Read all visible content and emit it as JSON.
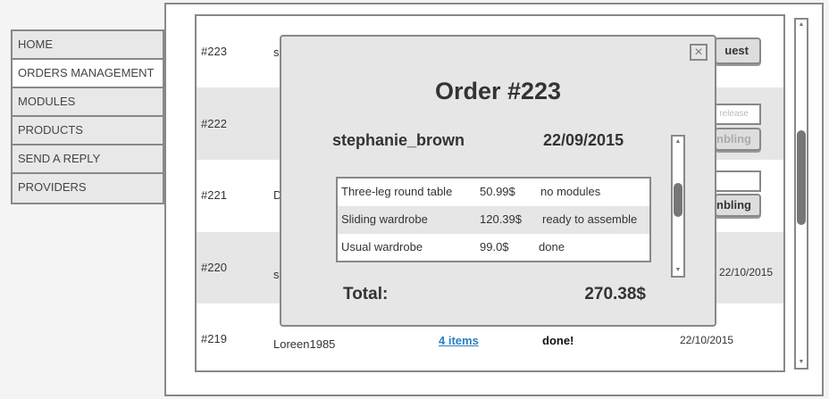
{
  "menu": {
    "items": [
      {
        "label": "HOME"
      },
      {
        "label": "ORDERS MANAGEMENT"
      },
      {
        "label": "MODULES"
      },
      {
        "label": "PRODUCTS"
      },
      {
        "label": "SEND A REPLY"
      },
      {
        "label": "PROVIDERS"
      }
    ]
  },
  "orders": {
    "rows": [
      {
        "id": "#223",
        "user_fragment": "s",
        "button_fragment": "uest"
      },
      {
        "id": "#222",
        "input_placeholder_fragment": "release",
        "button_fragment": "nbling"
      },
      {
        "id": "#221",
        "user_fragment": "D",
        "button_fragment": "nbling"
      },
      {
        "id": "#220",
        "user_fragment": "s",
        "date": "22/10/2015"
      },
      {
        "id": "#219",
        "user": "Loreen1985",
        "items_link": "4 items",
        "status": "done!",
        "date": "22/10/2015"
      }
    ]
  },
  "modal": {
    "title": "Order #223",
    "username": "stephanie_brown",
    "date": "22/09/2015",
    "items": [
      {
        "name": "Three-leg round table",
        "price": "50.99$",
        "status": "no modules"
      },
      {
        "name": "Sliding wardrobe",
        "price": "120.39$",
        "status": "ready to assemble"
      },
      {
        "name": "Usual wardrobe",
        "price": "99.0$",
        "status": "done"
      }
    ],
    "total_label": "Total:",
    "total_value": "270.38$",
    "close_icon": "×"
  },
  "colors": {
    "link": "#2a7fc4",
    "border": "#888888",
    "row_alt": "#e6e6e6"
  }
}
